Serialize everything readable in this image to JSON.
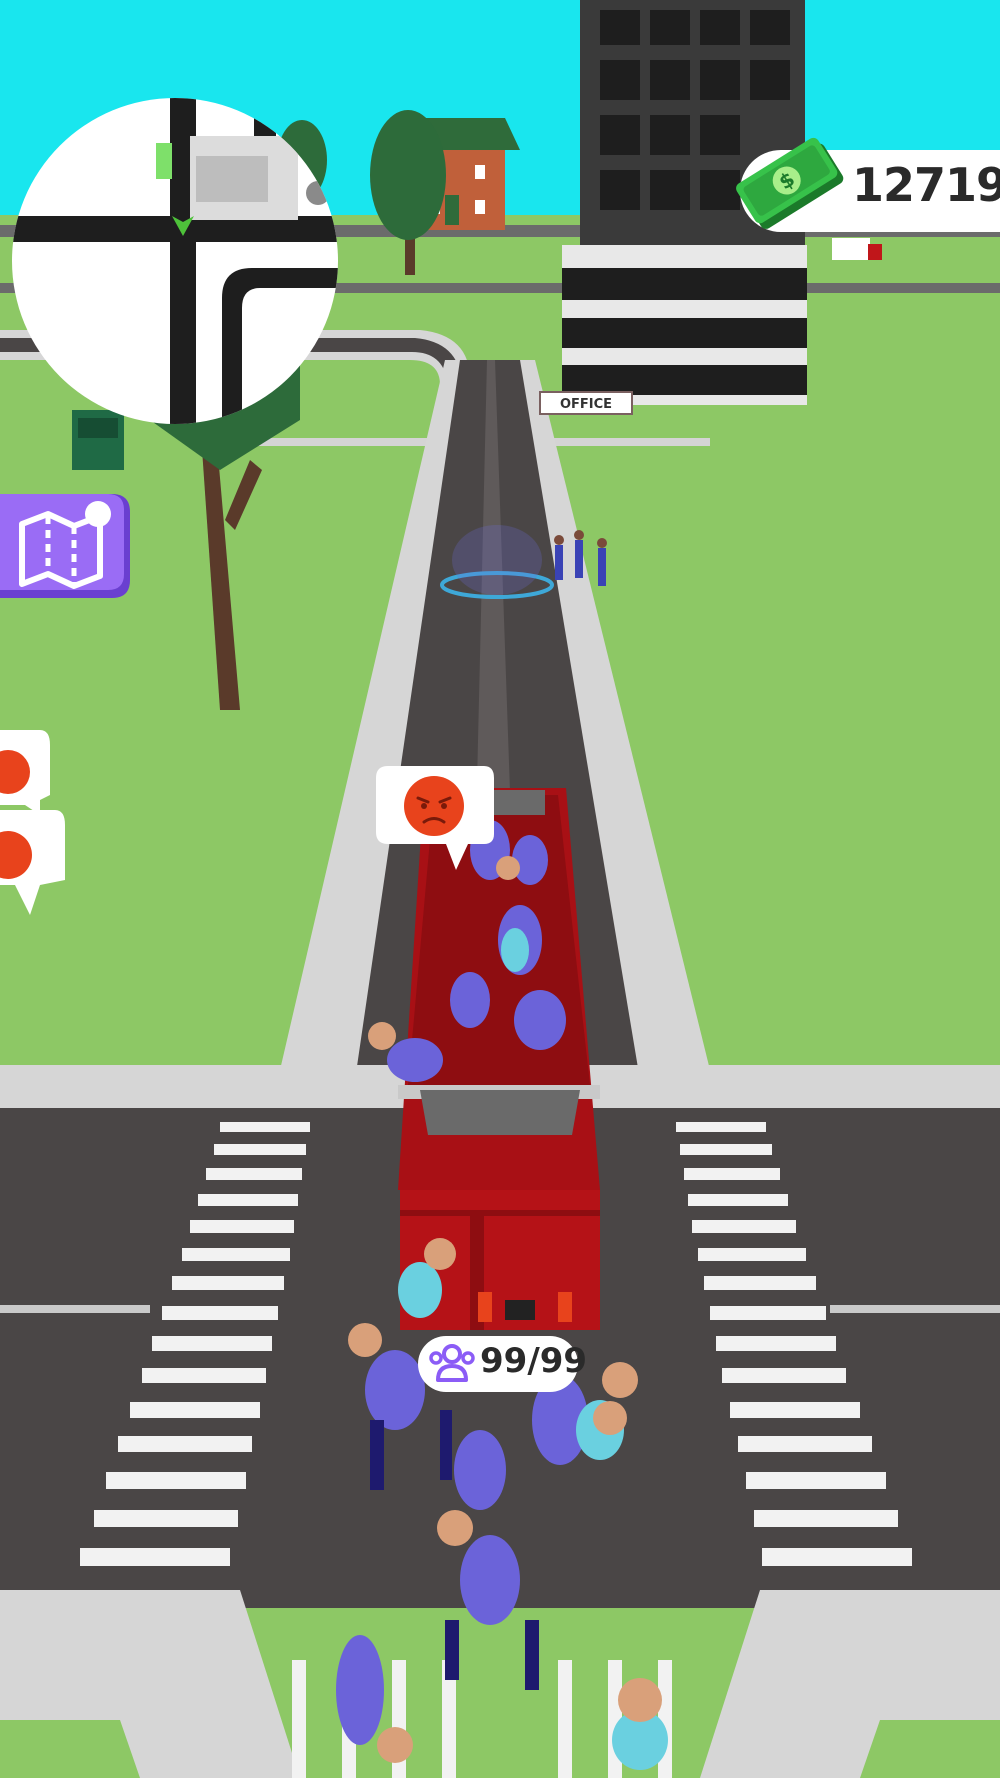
{
  "hud": {
    "money": "12719",
    "money_icon": "cash-icon",
    "minimap_icon": "minimap",
    "map_button_icon": "map-icon"
  },
  "bus": {
    "capacity": "99/99",
    "capacity_icon": "group-icon",
    "mood_icon": "angry-face-icon"
  },
  "world": {
    "building_sign": "OFFICE"
  },
  "colors": {
    "sky": "#19e6ee",
    "grass": "#8dc865",
    "road": "#4a4646",
    "sidewalk": "#d6d6d6",
    "bus": "#c0161a",
    "hud_accent": "#8b5cf6",
    "angry": "#e8431c"
  }
}
